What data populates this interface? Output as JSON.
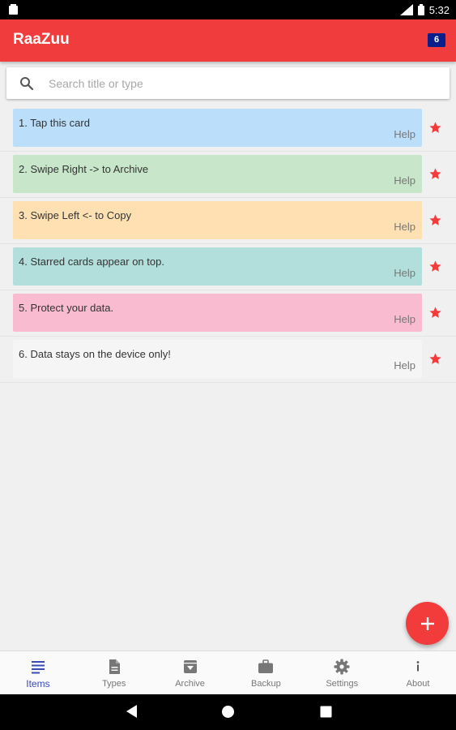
{
  "status_bar": {
    "time": "5:32",
    "icons": [
      "notification-icon",
      "signal-icon",
      "battery-icon"
    ]
  },
  "app_bar": {
    "title": "RaaZuu",
    "count_badge": "6",
    "color": "#f03c3c"
  },
  "search": {
    "placeholder": "Search title or type",
    "value": ""
  },
  "cards": [
    {
      "title": "1. Tap this card",
      "type_label": "Help",
      "color": "#bbdefb",
      "starred": true
    },
    {
      "title": "2. Swipe Right -> to Archive",
      "type_label": "Help",
      "color": "#c8e6c9",
      "starred": true
    },
    {
      "title": "3. Swipe Left <- to Copy",
      "type_label": "Help",
      "color": "#ffe0b2",
      "starred": true
    },
    {
      "title": "4. Starred cards appear on top.",
      "type_label": "Help",
      "color": "#b2dfdb",
      "starred": true
    },
    {
      "title": "5. Protect your data.",
      "type_label": "Help",
      "color": "#f8bbd0",
      "starred": true
    },
    {
      "title": "6. Data stays on the device only!",
      "type_label": "Help",
      "color": "#f5f5f5",
      "starred": true
    }
  ],
  "fab": {
    "icon": "plus-icon",
    "color": "#f23c3c"
  },
  "bottom_nav": [
    {
      "label": "Items",
      "icon": "list-icon",
      "active": true
    },
    {
      "label": "Types",
      "icon": "document-icon",
      "active": false
    },
    {
      "label": "Archive",
      "icon": "archive-icon",
      "active": false
    },
    {
      "label": "Backup",
      "icon": "briefcase-icon",
      "active": false
    },
    {
      "label": "Settings",
      "icon": "gear-icon",
      "active": false
    },
    {
      "label": "About",
      "icon": "info-icon",
      "active": false
    }
  ],
  "system_nav": [
    "back-icon",
    "home-icon",
    "recents-icon"
  ]
}
